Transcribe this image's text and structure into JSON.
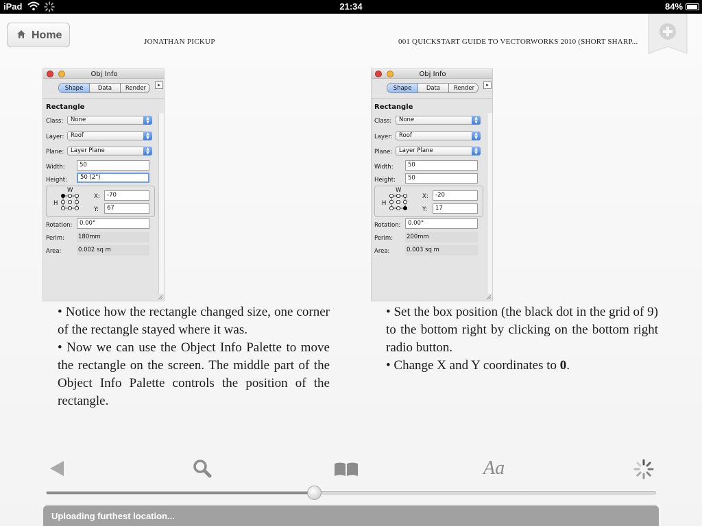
{
  "status_bar": {
    "device": "iPad",
    "time": "21:34",
    "battery": "84%",
    "battery_fraction": 0.84
  },
  "header": {
    "home_label": "Home",
    "author": "JONATHAN PICKUP",
    "book_title": "001 QUICKSTART GUIDE TO VECTORWORKS 2010 (SHORT SHARP..."
  },
  "palettes": [
    {
      "title": "Obj Info",
      "tabs": [
        "Shape",
        "Data",
        "Render"
      ],
      "menu_arrow": "▸",
      "object": "Rectangle",
      "class_label": "Class:",
      "class_value": "None",
      "layer_label": "Layer:",
      "layer_value": "Roof",
      "plane_label": "Plane:",
      "plane_value": "Layer Plane",
      "width_label": "Width:",
      "width_value": "50",
      "height_label": "Height:",
      "height_value": "50 (2\")",
      "w_letter": "W",
      "h_letter": "H",
      "x_label": "X:",
      "x_value": "-70",
      "y_label": "Y:",
      "y_value": "67",
      "rotation_label": "Rotation:",
      "rotation_value": "0.00°",
      "perim_label": "Perim:",
      "perim_value": "180mm",
      "area_label": "Area:",
      "area_value": "0.002 sq m",
      "box_position": "top-left"
    },
    {
      "title": "Obj Info",
      "tabs": [
        "Shape",
        "Data",
        "Render"
      ],
      "menu_arrow": "▸",
      "object": "Rectangle",
      "class_label": "Class:",
      "class_value": "None",
      "layer_label": "Layer:",
      "layer_value": "Roof",
      "plane_label": "Plane:",
      "plane_value": "Layer Plane",
      "width_label": "Width:",
      "width_value": "50",
      "height_label": "Height:",
      "height_value": "50",
      "w_letter": "W",
      "h_letter": "H",
      "x_label": "X:",
      "x_value": "-20",
      "y_label": "Y:",
      "y_value": "17",
      "rotation_label": "Rotation:",
      "rotation_value": "0.00°",
      "perim_label": "Perim:",
      "perim_value": "200mm",
      "area_label": "Area:",
      "area_value": "0.003 sq m",
      "box_position": "bottom-right"
    }
  ],
  "text": {
    "left_p1": "• Notice how the rectangle changed size, one corner of the rectangle stayed where it was.",
    "left_p2": "• Now we can use the Object Info Palette to move the rectangle on the screen. The middle part of the Object Info Palette controls the position of the rectangle.",
    "right_p1": "• Set the box position (the black dot in the grid of 9) to the bottom right by clicking on the bottom right radio button.",
    "right_p2_before": "• Change X and Y coordinates to ",
    "right_p2_bold": "0",
    "right_p2_after": "."
  },
  "toolbar": {
    "back_icon": "back-arrow-icon",
    "search_icon": "magnifier-icon",
    "bookmarks_icon": "open-book-icon",
    "font_label": "Aa",
    "loading_icon": "spinner-icon"
  },
  "progress": {
    "fraction": 0.44
  },
  "upload_status": "Uploading furthest location..."
}
